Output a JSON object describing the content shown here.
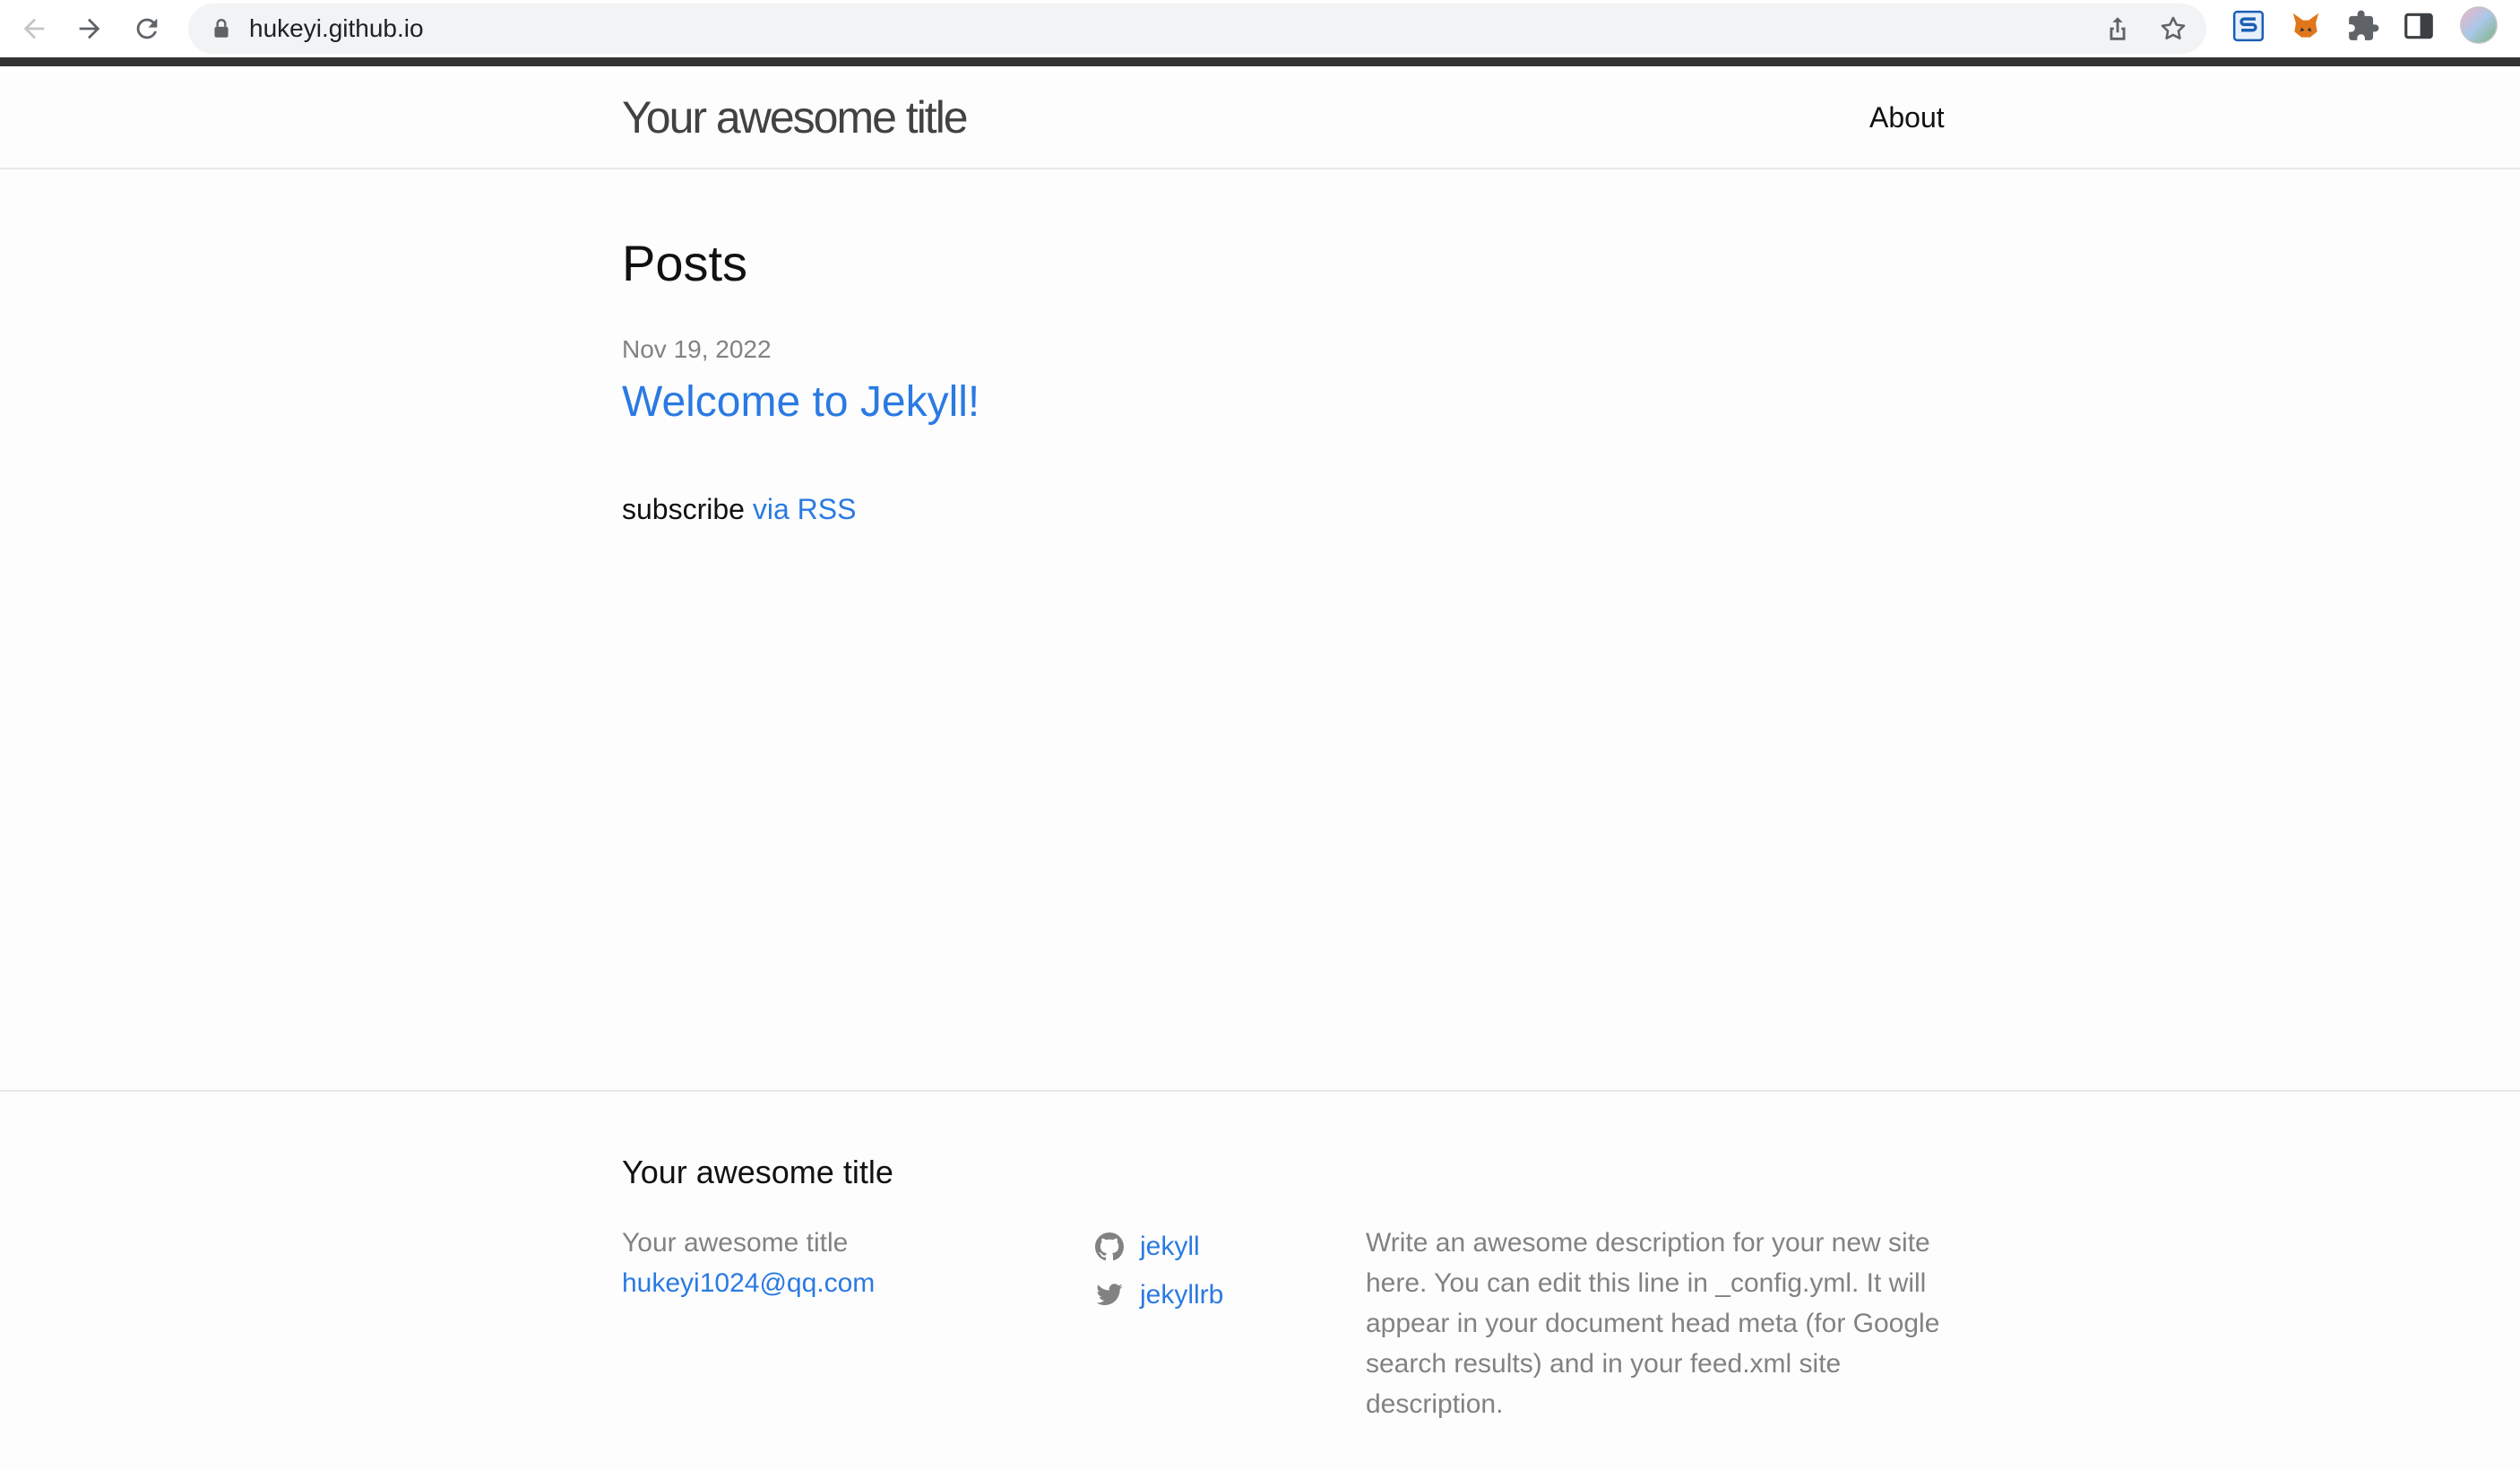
{
  "browser": {
    "url": "hukeyi.github.io",
    "icons": [
      "back-arrow-icon",
      "forward-arrow-icon",
      "reload-icon",
      "lock-icon",
      "share-icon",
      "bookmark-star-icon",
      "extension-s-icon",
      "metamask-fox-icon",
      "puzzle-icon",
      "side-panel-icon",
      "profile-avatar-icon"
    ]
  },
  "header": {
    "site_title": "Your awesome title",
    "nav": {
      "about": "About"
    }
  },
  "main": {
    "heading": "Posts",
    "posts": [
      {
        "date": "Nov 19, 2022",
        "title": "Welcome to Jekyll!"
      }
    ],
    "subscribe_text": "subscribe",
    "subscribe_link": "via RSS"
  },
  "footer": {
    "heading": "Your awesome title",
    "col1": {
      "name": "Your awesome title",
      "email": "hukeyi1024@qq.com"
    },
    "social": [
      {
        "icon": "github-icon",
        "label": "jekyll"
      },
      {
        "icon": "twitter-icon",
        "label": "jekyllrb"
      }
    ],
    "description": "Write an awesome description for your new site here. You can edit this line in _config.yml. It will appear in your document head meta (for Google search results) and in your feed.xml site description."
  },
  "colors": {
    "link": "#2a7ae2",
    "text": "#111111",
    "muted": "#828282",
    "header_bar": "#333333",
    "background": "#fdfdfd"
  }
}
